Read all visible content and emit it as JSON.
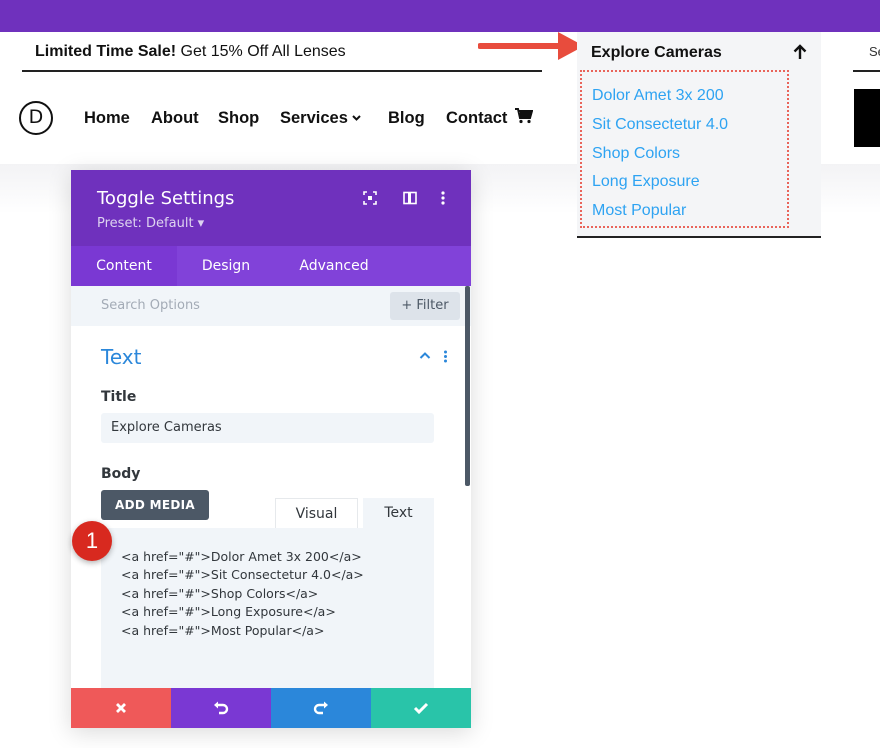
{
  "header": {
    "sale_bold": "Limited Time Sale!",
    "sale_text": " Get 15% Off All Lenses",
    "logo_letter": "D",
    "search_partial": "Se",
    "nav": [
      "Home",
      "About",
      "Shop",
      "Services",
      "Blog",
      "Contact"
    ],
    "cart_icon": "cart-icon"
  },
  "toggle": {
    "title": "Explore Cameras",
    "links": [
      "Dolor Amet 3x 200",
      "Sit Consectetur 4.0",
      "Shop Colors",
      "Long Exposure",
      "Most Popular"
    ]
  },
  "panel": {
    "title": "Toggle Settings",
    "preset": "Preset: Default ▾",
    "tabs": [
      "Content",
      "Design",
      "Advanced"
    ],
    "search_placeholder": "Search Options",
    "filter_label": "+ Filter",
    "section_title": "Text",
    "title_label": "Title",
    "title_value": "Explore Cameras",
    "body_label": "Body",
    "add_media": "ADD MEDIA",
    "editor_tabs": [
      "Visual",
      "Text"
    ],
    "code_lines": [
      "<a href=\"#\">Dolor Amet 3x 200</a>",
      "<a href=\"#\">Sit Consectetur 4.0</a>",
      "<a href=\"#\">Shop Colors</a>",
      "<a href=\"#\">Long Exposure</a>",
      "<a href=\"#\">Most Popular</a>"
    ]
  },
  "annotation": {
    "step_number": "1"
  },
  "colors": {
    "brand_purple": "#6f31bd",
    "link_blue": "#2ea3f2",
    "cancel_red": "#ef5959",
    "undo_purple": "#7a38d3",
    "redo_blue": "#2b87da",
    "save_green": "#29c4a9",
    "annotation_red": "#d8291f"
  }
}
